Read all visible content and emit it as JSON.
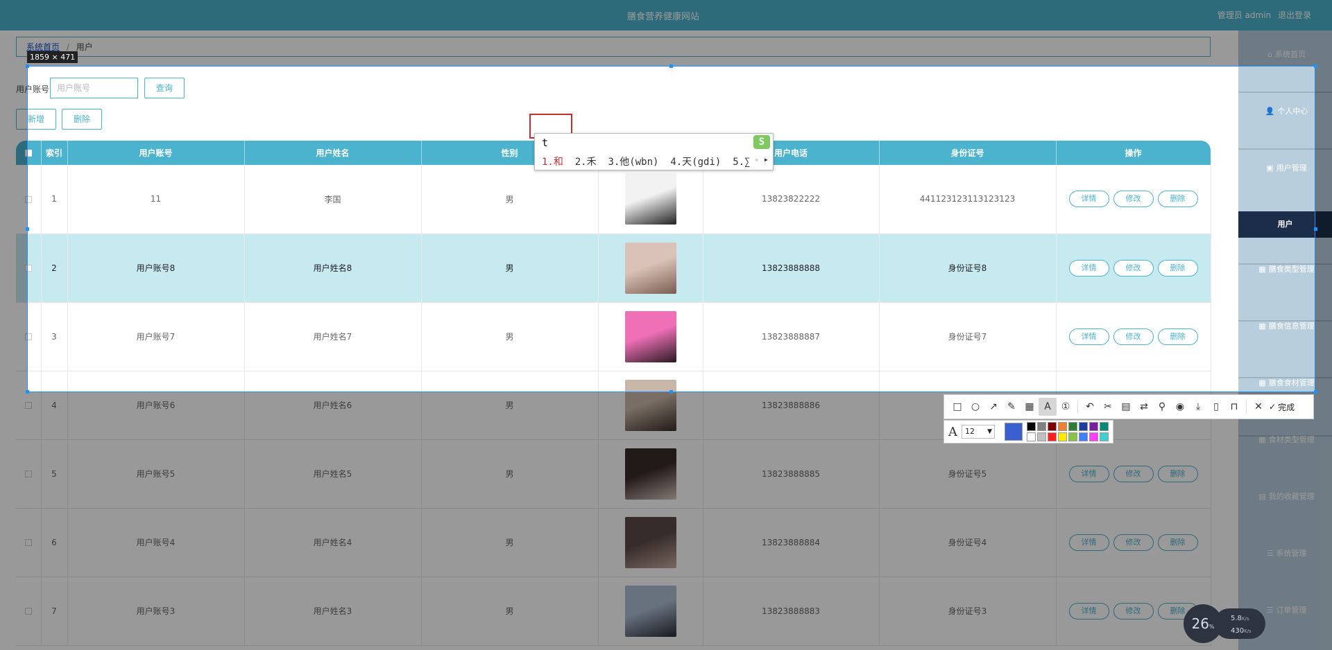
{
  "header": {
    "title": "膳食营养健康网站",
    "role": "管理员 admin",
    "logout": "退出登录"
  },
  "breadcrumb": {
    "home": "系统首页",
    "sep": "/",
    "current": "用户"
  },
  "search": {
    "label": "用户账号",
    "placeholder": "用户账号",
    "button": "查询"
  },
  "actions": {
    "add": "新增",
    "delete": "删除"
  },
  "table": {
    "headers": [
      "索引",
      "用户账号",
      "用户姓名",
      "性别",
      "头像",
      "用户电话",
      "身份证号",
      "操作"
    ],
    "ops": [
      "详情",
      "修改",
      "删除"
    ],
    "rows": [
      {
        "idx": "1",
        "account": "11",
        "name": "李国",
        "gender": "男",
        "phone": "13823822222",
        "idcard": "441123123113123123"
      },
      {
        "idx": "2",
        "account": "用户账号8",
        "name": "用户姓名8",
        "gender": "男",
        "phone": "13823888888",
        "idcard": "身份证号8"
      },
      {
        "idx": "3",
        "account": "用户账号7",
        "name": "用户姓名7",
        "gender": "男",
        "phone": "13823888887",
        "idcard": "身份证号7"
      },
      {
        "idx": "4",
        "account": "用户账号6",
        "name": "用户姓名6",
        "gender": "男",
        "phone": "13823888886",
        "idcard": ""
      },
      {
        "idx": "5",
        "account": "用户账号5",
        "name": "用户姓名5",
        "gender": "男",
        "phone": "13823888885",
        "idcard": "身份证号5"
      },
      {
        "idx": "6",
        "account": "用户账号4",
        "name": "用户姓名4",
        "gender": "男",
        "phone": "13823888884",
        "idcard": "身份证号4"
      },
      {
        "idx": "7",
        "account": "用户账号3",
        "name": "用户姓名3",
        "gender": "男",
        "phone": "13823888883",
        "idcard": "身份证号3"
      }
    ]
  },
  "sidebar": {
    "items": [
      {
        "label": "系统首页",
        "icon": "home-icon"
      },
      {
        "label": "个人中心",
        "icon": "user-icon"
      },
      {
        "label": "用户管理",
        "icon": "briefcase-icon"
      },
      {
        "label": "用户",
        "icon": ""
      },
      {
        "label": "膳食类型管理",
        "icon": "grid-icon"
      },
      {
        "label": "膳食信息管理",
        "icon": "grid-icon"
      },
      {
        "label": "膳食食材管理",
        "icon": "grid-icon"
      },
      {
        "label": "食材类型管理",
        "icon": "grid-icon"
      },
      {
        "label": "我的收藏管理",
        "icon": "file-icon"
      },
      {
        "label": "系统管理",
        "icon": "list-icon"
      },
      {
        "label": "订单管理",
        "icon": "list-icon"
      }
    ]
  },
  "screenshot_tool": {
    "size_label": "1859 × 471",
    "done_label": "完成",
    "font_size": "12",
    "current_color": "#3a5fd0",
    "palette": [
      "#000000",
      "#808080",
      "#800000",
      "#f08030",
      "#2e7d32",
      "#1f3f9f",
      "#7b1fa2",
      "#00897b",
      "#ffffff",
      "#c0c0c0",
      "#ff2020",
      "#ffeb00",
      "#8bc34a",
      "#4080ff",
      "#ff40ff",
      "#40d0d0"
    ]
  },
  "ime": {
    "typed": "t",
    "logo": "S",
    "candidates": [
      "1.和",
      "2.禾",
      "3.他(wbn)",
      "4.天(gdi)",
      "5.∑"
    ]
  },
  "net_meter": {
    "percent": "26",
    "percent_unit": "%",
    "up": "5.8",
    "down": "430",
    "unit": "K/s"
  },
  "colors": {
    "accent": "#4bb3cd",
    "sidebar_active": "#1c2d4a",
    "highlight_row": "#c7eaf0"
  }
}
